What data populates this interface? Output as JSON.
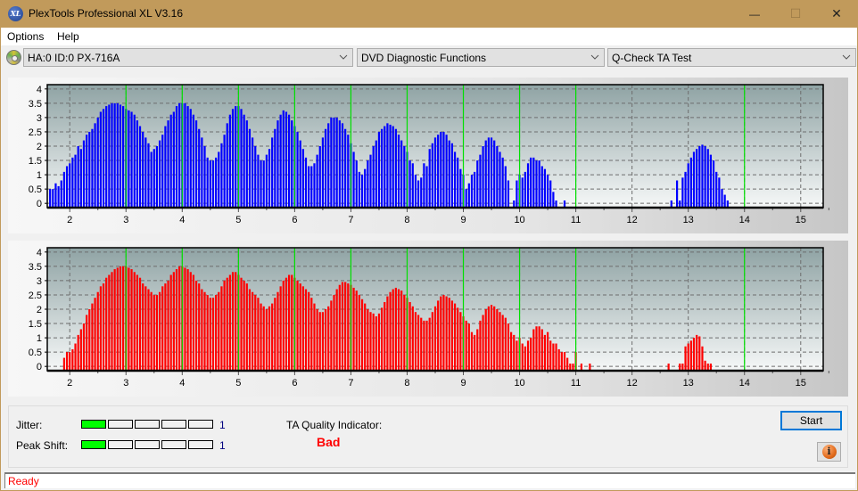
{
  "window": {
    "title": "PlexTools Professional XL V3.16",
    "app_icon_text": "XL",
    "controls": {
      "minimize": "—",
      "maximize": "☐",
      "close": "✕"
    }
  },
  "menu": {
    "items": [
      {
        "label": "Options"
      },
      {
        "label": "Help"
      }
    ]
  },
  "toolbar": {
    "drive_icon": "disc-icon",
    "drive_select": "HA:0 ID:0  PX-716A",
    "function_select": "DVD Diagnostic Functions",
    "test_select": "Q-Check TA Test"
  },
  "bottom": {
    "jitter_label": "Jitter:",
    "jitter_value": "1",
    "jitter_level": 1,
    "peak_shift_label": "Peak Shift:",
    "peak_shift_value": "1",
    "peak_shift_level": 1,
    "meter_segments": 5,
    "ta_quality_label": "TA Quality Indicator:",
    "ta_quality_value": "Bad",
    "start_label": "Start",
    "info_icon": "i"
  },
  "status": {
    "text": "Ready"
  },
  "chart_data": [
    {
      "type": "bar",
      "title": "",
      "series_color": "#0000ff",
      "xlabel": "",
      "ylabel": "",
      "xlim": [
        1.6,
        15.4
      ],
      "ylim": [
        -0.15,
        4.15
      ],
      "xticks": [
        2,
        3,
        4,
        5,
        6,
        7,
        8,
        9,
        10,
        11,
        12,
        13,
        14,
        15
      ],
      "yticks": [
        0,
        0.5,
        1,
        1.5,
        2,
        2.5,
        3,
        3.5,
        4
      ],
      "ytick_labels": [
        "0",
        "0.5",
        "1",
        "1.5",
        "2",
        "2.5",
        "3",
        "3.5",
        "4"
      ],
      "marker_lines_x": [
        3,
        4,
        5,
        6,
        7,
        8,
        9,
        10,
        11,
        14
      ],
      "grid": true,
      "x_start": 1.65,
      "x_step": 0.05,
      "values": [
        0.5,
        0.5,
        0.7,
        0.6,
        0.8,
        1.1,
        1.3,
        1.4,
        1.6,
        1.7,
        2.0,
        1.9,
        2.2,
        2.4,
        2.5,
        2.6,
        2.8,
        3.0,
        3.2,
        3.3,
        3.4,
        3.45,
        3.5,
        3.5,
        3.5,
        3.45,
        3.4,
        3.3,
        3.25,
        3.2,
        3.1,
        2.9,
        2.7,
        2.5,
        2.3,
        2.1,
        1.8,
        1.9,
        2.0,
        2.2,
        2.4,
        2.7,
        2.9,
        3.1,
        3.2,
        3.4,
        3.5,
        3.5,
        3.5,
        3.4,
        3.3,
        3.1,
        2.9,
        2.6,
        2.3,
        2.0,
        1.6,
        1.5,
        1.5,
        1.6,
        1.8,
        2.1,
        2.4,
        2.8,
        3.1,
        3.3,
        3.4,
        3.4,
        3.3,
        3.1,
        2.9,
        2.6,
        2.3,
        2.0,
        1.7,
        1.5,
        1.5,
        1.7,
        1.9,
        2.3,
        2.6,
        2.9,
        3.1,
        3.25,
        3.2,
        3.1,
        2.9,
        2.7,
        2.5,
        2.2,
        1.9,
        1.6,
        1.3,
        1.3,
        1.4,
        1.7,
        2.0,
        2.3,
        2.6,
        2.8,
        3.0,
        3.0,
        3.0,
        2.9,
        2.8,
        2.6,
        2.4,
        2.1,
        1.8,
        1.5,
        1.1,
        1.0,
        1.2,
        1.5,
        1.7,
        2.0,
        2.2,
        2.5,
        2.6,
        2.7,
        2.8,
        2.75,
        2.7,
        2.6,
        2.4,
        2.2,
        2.0,
        1.8,
        1.5,
        1.4,
        1.0,
        0.8,
        0.9,
        1.4,
        1.3,
        1.9,
        2.1,
        2.3,
        2.4,
        2.5,
        2.5,
        2.4,
        2.2,
        2.1,
        1.8,
        1.6,
        1.2,
        1.0,
        0.5,
        0.7,
        1.0,
        1.1,
        1.5,
        1.7,
        2.0,
        2.2,
        2.3,
        2.3,
        2.2,
        2.0,
        1.8,
        1.6,
        1.3,
        0.8,
        0.0,
        0.1,
        0.8,
        1.0,
        0.9,
        1.1,
        1.4,
        1.6,
        1.6,
        1.5,
        1.5,
        1.3,
        1.2,
        1.0,
        0.8,
        0.4,
        0.1,
        0.0,
        0.0,
        0.1,
        0.0,
        0,
        0,
        0,
        0,
        0,
        0,
        0,
        0,
        0,
        0,
        0,
        0,
        0,
        0,
        0,
        0,
        0,
        0,
        0,
        0,
        0,
        0,
        0,
        0,
        0,
        0,
        0,
        0,
        0,
        0,
        0,
        0,
        0,
        0,
        0,
        0,
        0.1,
        0.0,
        0.8,
        0.1,
        0.9,
        1.1,
        1.4,
        1.6,
        1.8,
        1.9,
        2.0,
        2.05,
        2.0,
        1.9,
        1.7,
        1.5,
        1.1,
        0.9,
        0.5,
        0.3,
        0.1
      ],
      "quality_curve_color": "#00ff00"
    },
    {
      "type": "bar",
      "title": "",
      "series_color": "#ff0000",
      "xlabel": "",
      "ylabel": "",
      "xlim": [
        1.6,
        15.4
      ],
      "ylim": [
        -0.15,
        4.15
      ],
      "xticks": [
        2,
        3,
        4,
        5,
        6,
        7,
        8,
        9,
        10,
        11,
        12,
        13,
        14,
        15
      ],
      "yticks": [
        0,
        0.5,
        1,
        1.5,
        2,
        2.5,
        3,
        3.5,
        4
      ],
      "ytick_labels": [
        "0",
        "0.5",
        "1",
        "1.5",
        "2",
        "2.5",
        "3",
        "3.5",
        "4"
      ],
      "marker_lines_x": [
        3,
        4,
        5,
        6,
        7,
        8,
        9,
        10,
        11,
        14
      ],
      "grid": true,
      "x_start": 1.65,
      "x_step": 0.05,
      "values": [
        0,
        0,
        0,
        0,
        0,
        0.3,
        0.5,
        0.5,
        0.6,
        0.8,
        1.1,
        1.3,
        1.5,
        1.8,
        2.0,
        2.2,
        2.4,
        2.6,
        2.8,
        2.9,
        3.1,
        3.2,
        3.3,
        3.4,
        3.45,
        3.5,
        3.5,
        3.5,
        3.45,
        3.4,
        3.3,
        3.2,
        3.1,
        2.9,
        2.8,
        2.7,
        2.6,
        2.5,
        2.5,
        2.6,
        2.8,
        2.9,
        3.0,
        3.2,
        3.3,
        3.4,
        3.5,
        3.5,
        3.45,
        3.4,
        3.3,
        3.2,
        3.0,
        2.9,
        2.7,
        2.6,
        2.5,
        2.4,
        2.4,
        2.5,
        2.6,
        2.8,
        3.0,
        3.1,
        3.2,
        3.3,
        3.3,
        3.2,
        3.1,
        3.0,
        2.9,
        2.7,
        2.6,
        2.5,
        2.4,
        2.2,
        2.1,
        2.0,
        2.1,
        2.2,
        2.4,
        2.6,
        2.8,
        3.0,
        3.1,
        3.2,
        3.2,
        3.1,
        3.0,
        2.9,
        2.8,
        2.7,
        2.6,
        2.4,
        2.2,
        2.0,
        1.9,
        1.9,
        2.0,
        2.1,
        2.3,
        2.5,
        2.7,
        2.85,
        2.95,
        2.95,
        2.9,
        2.85,
        2.75,
        2.65,
        2.5,
        2.35,
        2.2,
        2.0,
        1.9,
        1.85,
        1.75,
        1.85,
        2.05,
        2.25,
        2.45,
        2.6,
        2.7,
        2.75,
        2.7,
        2.65,
        2.5,
        2.4,
        2.25,
        2.1,
        1.9,
        1.8,
        1.7,
        1.6,
        1.6,
        1.7,
        1.9,
        2.1,
        2.3,
        2.45,
        2.5,
        2.45,
        2.4,
        2.3,
        2.2,
        2.05,
        1.9,
        1.75,
        1.6,
        1.5,
        1.2,
        1.1,
        1.3,
        1.6,
        1.8,
        2.0,
        2.1,
        2.15,
        2.1,
        2.0,
        1.9,
        1.8,
        1.7,
        1.5,
        1.2,
        1.1,
        0.9,
        1.0,
        0.8,
        0.7,
        0.9,
        1.0,
        1.3,
        1.4,
        1.4,
        1.3,
        1.1,
        1.2,
        0.9,
        0.8,
        0.8,
        0.6,
        0.5,
        0.5,
        0.3,
        0.1,
        0.1,
        0.5,
        0.0,
        0.1,
        0,
        0,
        0.1,
        0,
        0,
        0,
        0,
        0,
        0,
        0,
        0,
        0,
        0,
        0,
        0,
        0,
        0,
        0,
        0,
        0,
        0,
        0,
        0,
        0,
        0,
        0,
        0,
        0,
        0,
        0,
        0.1,
        0,
        0,
        0,
        0.1,
        0.1,
        0.7,
        0.8,
        0.9,
        1.0,
        1.1,
        1.05,
        0.7,
        0.2,
        0.1,
        0.1,
        0,
        0,
        0,
        0,
        0
      ]
    }
  ]
}
